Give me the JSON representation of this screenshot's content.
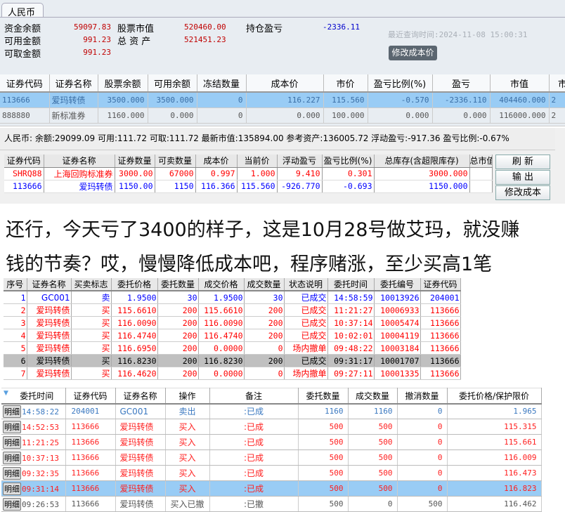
{
  "panel1": {
    "tab": "人民币",
    "labels": {
      "fund_balance": "资金余额",
      "available": "可用金额",
      "withdrawable": "可取金额",
      "stock_value": "股票市值",
      "total_assets": "总 资 产",
      "position_pl": "持仓盈亏"
    },
    "values": {
      "fund_balance": "59097.83",
      "available": "991.23",
      "withdrawable": "991.23",
      "stock_value": "520460.00",
      "total_assets": "521451.23",
      "position_pl": "-2336.11"
    },
    "query_time": "最近查询时间:2024-11-08 15:00:31",
    "modify_cost_button": "修改成本价",
    "columns": [
      "证券代码",
      "证券名称",
      "股票余额",
      "可用余额",
      "冻结数量",
      "成本价",
      "市价",
      "盈亏比例(%)",
      "盈亏",
      "市值",
      "市"
    ],
    "rows": [
      [
        "113666",
        "爱玛转债",
        "3500.000",
        "3500.000",
        "0",
        "116.227",
        "115.560",
        "-0.570",
        "-2336.110",
        "404460.000",
        "2"
      ],
      [
        "888880",
        "新标准券",
        "1160.000",
        "0.000",
        "0",
        "0.000",
        "100.000",
        "0.000",
        "0.000",
        "116000.000",
        "2"
      ]
    ]
  },
  "panel2": {
    "info": "人民币: 余额:29099.09  可用:111.72  可取:111.72  最新市值:135894.00  参考资产:136005.72  浮动盈亏:-917.36  盈亏比例:-0.67%",
    "columns": [
      "证券代码",
      "证券名称",
      "证券数量",
      "可卖数量",
      "成本价",
      "当前价",
      "浮动盈亏",
      "盈亏比例(%)",
      "总库存(含超限库存)",
      "总市值"
    ],
    "rows": [
      [
        "SHRQ88",
        "上海回购标准券",
        "3000.00",
        "67000",
        "0.997",
        "1.000",
        "9.410",
        "0.301",
        "3000.000",
        ""
      ],
      [
        "113666",
        "爱玛转债",
        "1150.00",
        "1150",
        "116.366",
        "115.560",
        "-926.770",
        "-0.693",
        "1150.000",
        ""
      ]
    ],
    "row_colors": [
      "#ff0000",
      "#0000ff"
    ],
    "buttons": {
      "refresh": "刷 新",
      "export": "输 出",
      "modify_cost": "修改成本"
    }
  },
  "comment": {
    "line1": "还行，今天亏了3400的样子，这是10月28号做艾玛，就没赚",
    "line2": "钱的节奏？哎，慢慢降低成本吧，程序赌涨，至少买高1笔"
  },
  "panel3": {
    "columns": [
      "序号",
      "证券名称",
      "买卖标志",
      "委托价格",
      "委托数量",
      "成交价格",
      "成交数量",
      "状态说明",
      "委托时间",
      "委托编号",
      "证券代码"
    ],
    "rows": [
      [
        "1",
        "GC001",
        "卖",
        "1.9500",
        "30",
        "1.9500",
        "30",
        "已成交",
        "14:58:59",
        "10013926",
        "204001"
      ],
      [
        "2",
        "爱玛转债",
        "买",
        "115.6610",
        "200",
        "115.6610",
        "200",
        "已成交",
        "11:21:27",
        "10006933",
        "113666"
      ],
      [
        "3",
        "爱玛转债",
        "买",
        "116.0090",
        "200",
        "116.0090",
        "200",
        "已成交",
        "10:37:14",
        "10005474",
        "113666"
      ],
      [
        "4",
        "爱玛转债",
        "买",
        "116.4740",
        "200",
        "116.4740",
        "200",
        "已成交",
        "10:02:01",
        "10004119",
        "113666"
      ],
      [
        "5",
        "爱玛转债",
        "买",
        "116.6950",
        "200",
        "0.0000",
        "0",
        "场内撤单",
        "09:48:22",
        "10003184",
        "113666"
      ],
      [
        "6",
        "爱玛转债",
        "买",
        "116.8230",
        "200",
        "116.8230",
        "200",
        "已成交",
        "09:31:17",
        "10001707",
        "113666"
      ],
      [
        "7",
        "爱玛转债",
        "买",
        "116.4620",
        "200",
        "0.0000",
        "0",
        "场内撤单",
        "09:27:11",
        "10001335",
        "113666"
      ]
    ]
  },
  "panel4": {
    "columns": [
      "委托时间",
      "证券代码",
      "证券名称",
      "操作",
      "备注",
      "委托数量",
      "成交数量",
      "撤消数量",
      "委托价格/保护限价"
    ],
    "detail_button": "明细",
    "rows": [
      [
        "14:58:22",
        "204001",
        "GC001",
        "卖出",
        ":已成",
        "1160",
        "1160",
        "0",
        "1.965"
      ],
      [
        "14:52:53",
        "113666",
        "爱玛转债",
        "买入",
        ":已成",
        "500",
        "500",
        "0",
        "115.315"
      ],
      [
        "11:21:25",
        "113666",
        "爱玛转债",
        "买入",
        ":已成",
        "500",
        "500",
        "0",
        "115.661"
      ],
      [
        "10:37:13",
        "113666",
        "爱玛转债",
        "买入",
        ":已成",
        "500",
        "500",
        "0",
        "116.009"
      ],
      [
        "09:32:35",
        "113666",
        "爱玛转债",
        "买入",
        ":已成",
        "500",
        "500",
        "0",
        "116.473"
      ],
      [
        "09:31:14",
        "113666",
        "爱玛转债",
        "买入",
        ":已成",
        "500",
        "500",
        "0",
        "116.823"
      ],
      [
        "09:26:53",
        "113666",
        "爱玛转债",
        "买入已撤",
        ":已撤",
        "500",
        "0",
        "500",
        "116.462"
      ]
    ],
    "row_colors": [
      "#3a78c0",
      "#ff2020",
      "#ff2020",
      "#ff2020",
      "#ff2020",
      "#ff2020",
      "#555555"
    ]
  }
}
